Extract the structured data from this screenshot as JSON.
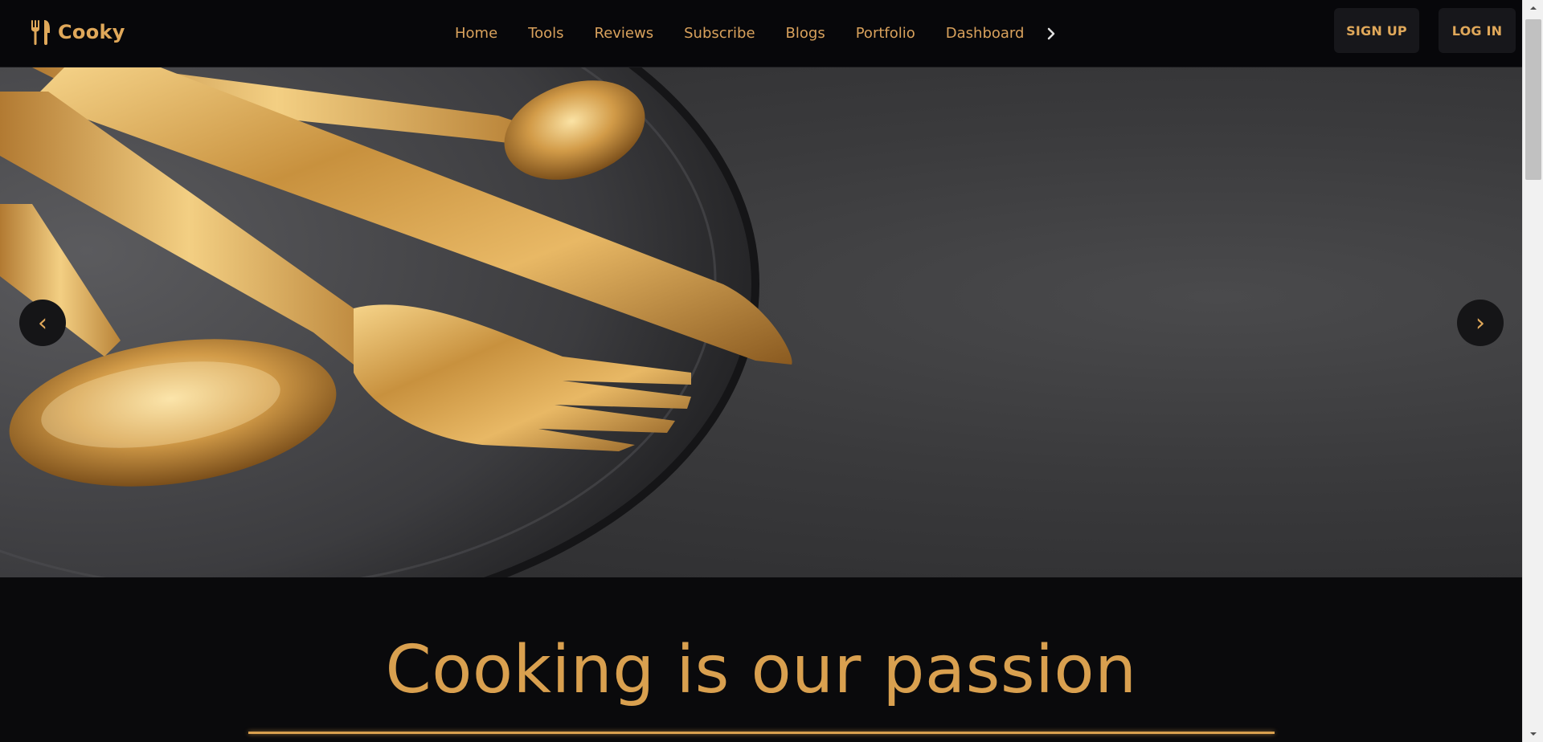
{
  "brand": {
    "name": "Cooky",
    "icon": "fork-knife-icon",
    "color": "#e0a85a"
  },
  "nav": {
    "links": [
      {
        "label": "Home"
      },
      {
        "label": "Tools"
      },
      {
        "label": "Reviews"
      },
      {
        "label": "Subscribe"
      },
      {
        "label": "Blogs"
      },
      {
        "label": "Portfolio"
      },
      {
        "label": "Dashboard"
      }
    ],
    "more_icon": "chevron-right-icon"
  },
  "auth": {
    "signup_label": "SIGN UP",
    "login_label": "LOG IN"
  },
  "hero": {
    "prev_label": "‹",
    "next_label": "›",
    "prev_icon": "chevron-left-icon",
    "next_icon": "chevron-right-icon"
  },
  "intro": {
    "title": "Cooking is our passion"
  },
  "colors": {
    "accent": "#d9a04f",
    "background": "#0a0a0c",
    "header": "#07070a",
    "button": "#17171b"
  }
}
